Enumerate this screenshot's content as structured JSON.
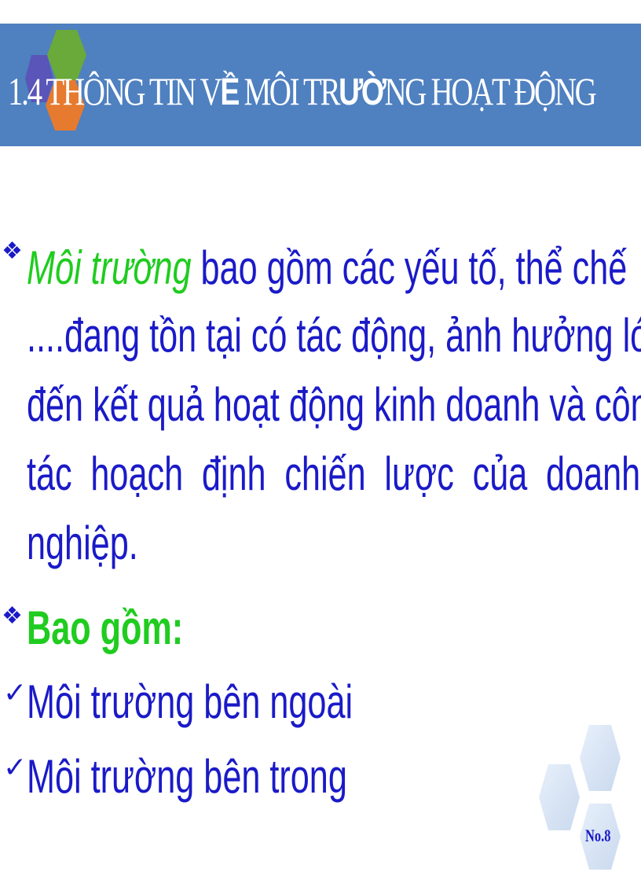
{
  "header": {
    "title_prefix": "1.4 THÔNG TIN V",
    "title_big1": "Ề",
    "title_mid": " MÔI TR",
    "title_big2": "ƯỜ",
    "title_end": "NG HOẠT ĐỘNG"
  },
  "bullet1": {
    "icon": "diamond-bullet-icon",
    "emphasis": "Môi trường",
    "line1_rest": " bao gồm các yếu tố, thể chế",
    "line2": "....đang tồn tại có tác động, ảnh hưởng lớn",
    "line3": "đến kết quả hoạt động kinh doanh và công",
    "line4_words": [
      "tác",
      "hoạch",
      "định",
      "chiến",
      "lược",
      "của",
      "doanh"
    ],
    "line5": "nghiệp."
  },
  "bullet2": {
    "icon": "diamond-bullet-icon",
    "label": "Bao gồm:"
  },
  "items": [
    {
      "icon": "checkmark-icon",
      "label": "Môi trường bên ngoài"
    },
    {
      "icon": "checkmark-icon",
      "label": "Môi trường bên trong"
    }
  ],
  "page_number": "No.8",
  "colors": {
    "header_bg": "#4f80c0",
    "body_text": "#1a1ac8",
    "accent_green": "#1fcc1f"
  }
}
